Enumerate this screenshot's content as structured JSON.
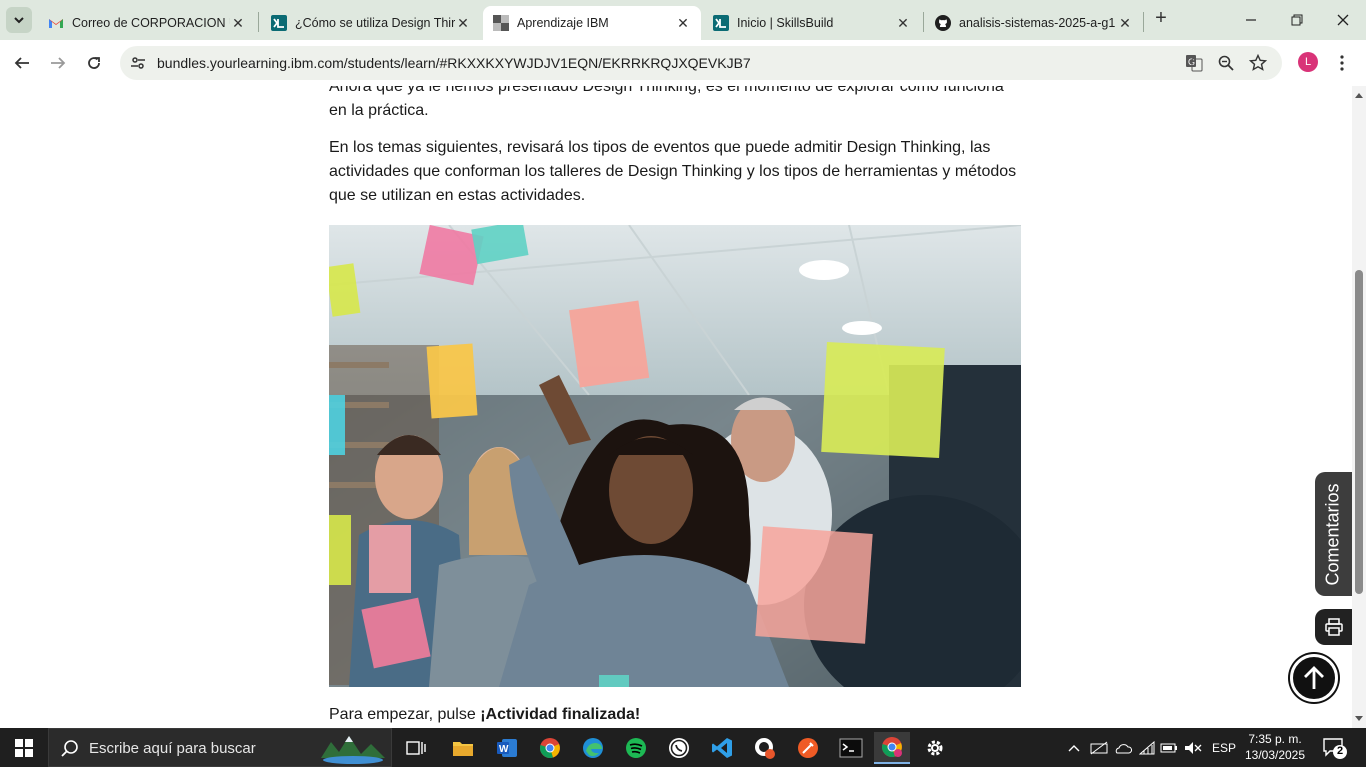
{
  "tabs": [
    {
      "title": "Correo de CORPORACION U",
      "icon": "gmail-icon",
      "active": false
    },
    {
      "title": "¿Cómo se utiliza Design Thir",
      "icon": "yourlearning-icon",
      "active": false
    },
    {
      "title": "Aprendizaje IBM",
      "icon": "ibm-icon",
      "active": true
    },
    {
      "title": "Inicio | SkillsBuild",
      "icon": "yourlearning-icon",
      "active": false
    },
    {
      "title": "analisis-sistemas-2025-a-g1",
      "icon": "github-icon",
      "active": false
    }
  ],
  "address_bar": {
    "url": "bundles.yourlearning.ibm.com/students/learn/#RKXXKXYWJDJV1EQN/EKRRKRQJXQEVKJB7"
  },
  "avatar_letter": "L",
  "content": {
    "intro_partial": "Ahora que ya le hemos presentado Design Thinking, es el momento de explorar cómo funciona",
    "intro_partial_2": "en la práctica.",
    "paragraph": "En los temas siguientes, revisará los tipos de eventos que puede admitir Design Thinking, las actividades que conforman los talleres de Design Thinking y los tipos de herramientas y métodos que se utilizan en estas actividades.",
    "start_prefix": "Para empezar, pulse ",
    "start_bold": "¡Actividad finalizada!"
  },
  "feedback_label": "Comentarios",
  "taskbar": {
    "search_placeholder": "Escribe aquí para buscar",
    "language": "ESP",
    "time": "7:35 p. m.",
    "date": "13/03/2025",
    "notifications": "2"
  },
  "colors": {
    "chrome_frame": "#dfe8df",
    "taskbar": "#1f1f1f",
    "accent": "#7fb2e5"
  }
}
